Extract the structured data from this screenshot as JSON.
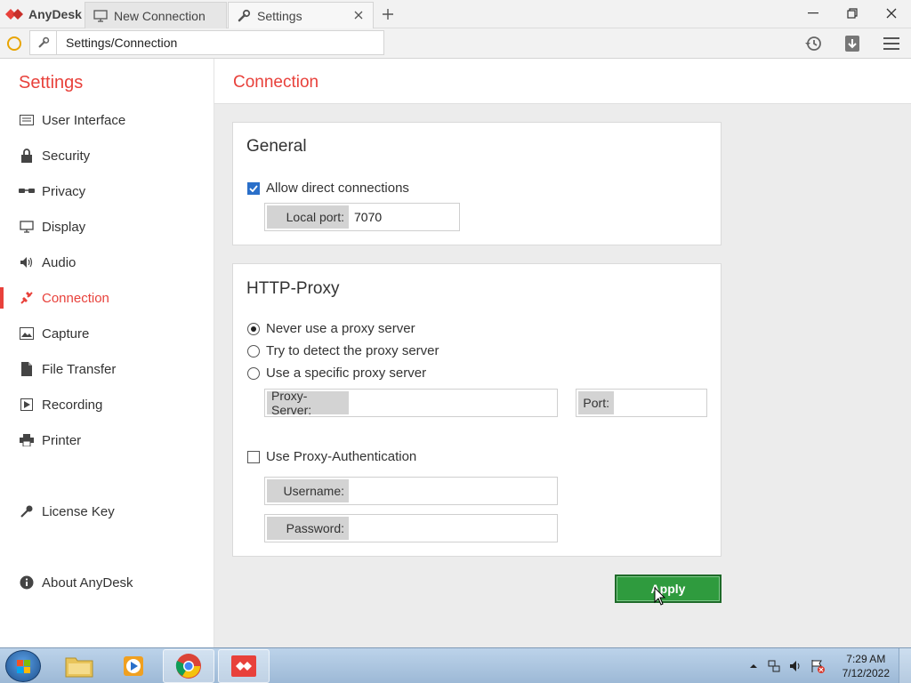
{
  "titlebar": {
    "app_name": "AnyDesk",
    "tabs": [
      {
        "label": "New Connection",
        "icon": "monitor-icon"
      },
      {
        "label": "Settings",
        "icon": "wrench-icon"
      }
    ]
  },
  "address_bar": {
    "value": "Settings/Connection"
  },
  "sidebar": {
    "title": "Settings",
    "items": [
      {
        "label": "User Interface",
        "icon": "keyboard-icon"
      },
      {
        "label": "Security",
        "icon": "lock-icon"
      },
      {
        "label": "Privacy",
        "icon": "glasses-icon"
      },
      {
        "label": "Display",
        "icon": "monitor-icon"
      },
      {
        "label": "Audio",
        "icon": "speaker-icon"
      },
      {
        "label": "Connection",
        "icon": "connection-icon",
        "active": true
      },
      {
        "label": "Capture",
        "icon": "image-icon"
      },
      {
        "label": "File Transfer",
        "icon": "file-icon"
      },
      {
        "label": "Recording",
        "icon": "play-icon"
      },
      {
        "label": "Printer",
        "icon": "printer-icon"
      }
    ],
    "license": {
      "label": "License Key",
      "icon": "key-icon"
    },
    "about": {
      "label": "About AnyDesk",
      "icon": "info-icon"
    }
  },
  "main": {
    "title": "Connection",
    "general": {
      "title": "General",
      "allow_direct_label": "Allow direct connections",
      "allow_direct_checked": true,
      "local_port_label": "Local port:",
      "local_port_value": "7070"
    },
    "proxy": {
      "title": "HTTP-Proxy",
      "options": [
        {
          "label": "Never use a proxy server",
          "checked": true
        },
        {
          "label": "Try to detect the proxy server",
          "checked": false
        },
        {
          "label": "Use a specific proxy server",
          "checked": false
        }
      ],
      "server_label": "Proxy-Server:",
      "server_value": "",
      "port_label": "Port:",
      "port_value": "",
      "auth_label": "Use Proxy-Authentication",
      "auth_checked": false,
      "username_label": "Username:",
      "username_value": "",
      "password_label": "Password:",
      "password_value": ""
    },
    "apply_label": "Apply"
  },
  "taskbar": {
    "time": "7:29 AM",
    "date": "7/12/2022"
  },
  "colors": {
    "accent": "#e8413b",
    "apply_green": "#2f9b3e",
    "checkbox_blue": "#2a6fc9"
  }
}
